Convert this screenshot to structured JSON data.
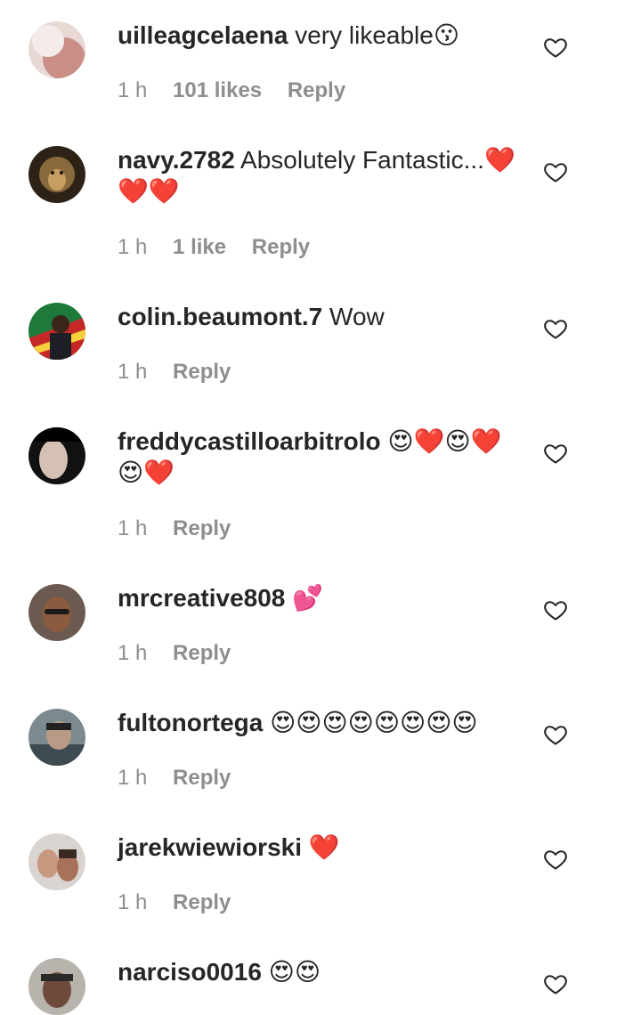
{
  "comments": [
    {
      "username": "uilleagcelaena",
      "text": "very likeable😗",
      "time": "1 h",
      "likes": "101 likes",
      "reply": "Reply"
    },
    {
      "username": "navy.2782",
      "text": "Absolutely Fantastic...❤️❤️❤️",
      "time": "1 h",
      "likes": "1 like",
      "reply": "Reply"
    },
    {
      "username": "colin.beaumont.7",
      "text": "Wow",
      "time": "1 h",
      "likes": "",
      "reply": "Reply"
    },
    {
      "username": "freddycastilloarbitrolo",
      "text": "😍❤️😍❤️😍❤️",
      "time": "1 h",
      "likes": "",
      "reply": "Reply"
    },
    {
      "username": "mrcreative808",
      "text": "💕",
      "time": "1 h",
      "likes": "",
      "reply": "Reply"
    },
    {
      "username": "fultonortega",
      "text": "😍😍😍😍😍😍😍😍",
      "time": "1 h",
      "likes": "",
      "reply": "Reply"
    },
    {
      "username": "jarekwiewiorski",
      "text": "❤️",
      "time": "1 h",
      "likes": "",
      "reply": "Reply"
    },
    {
      "username": "narciso0016",
      "text": "😍😍",
      "time": "",
      "likes": "",
      "reply": ""
    }
  ],
  "icons": {
    "like": "heart-outline-icon",
    "avatar": "user-avatar"
  },
  "colors": {
    "text": "#262626",
    "meta": "#8e8e8e",
    "background": "#ffffff"
  }
}
